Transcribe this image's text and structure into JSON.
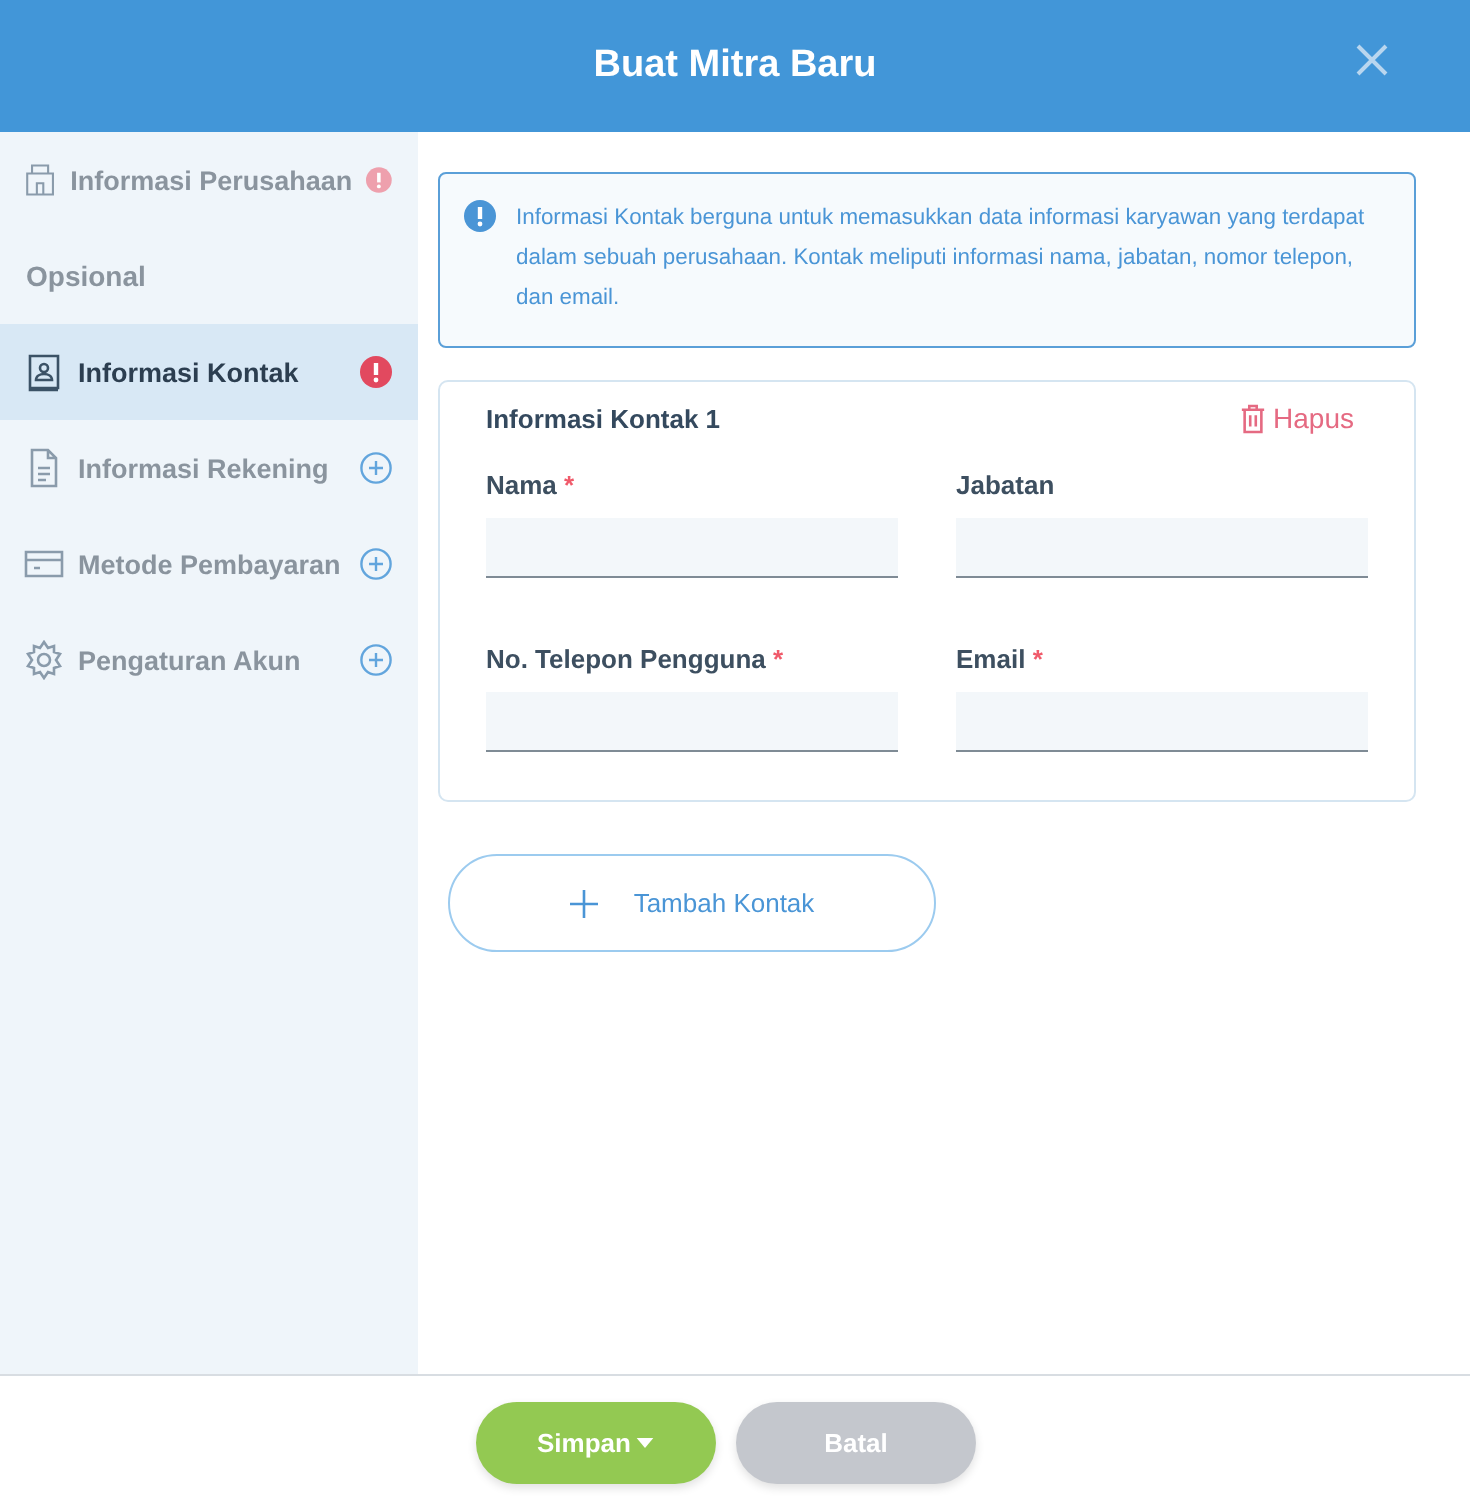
{
  "dialog": {
    "title": "Buat Mitra Baru"
  },
  "sidebar": {
    "items": [
      {
        "kind": "item",
        "label": "Informasi Perusahaan",
        "selected": false,
        "alert": true
      },
      {
        "kind": "section",
        "label": "Opsional"
      },
      {
        "kind": "item",
        "label": "Informasi Kontak",
        "selected": true,
        "alert": true
      },
      {
        "kind": "item",
        "label": "Informasi Rekening",
        "selected": false,
        "alert": false
      },
      {
        "kind": "item",
        "label": "Metode Pembayaran",
        "selected": false,
        "alert": false
      },
      {
        "kind": "item",
        "label": "Pengaturan Akun",
        "selected": false,
        "alert": false
      }
    ]
  },
  "info": "Informasi Kontak berguna untuk memasukkan data informasi karyawan yang terdapat dalam sebuah perusahaan. Kontak meliputi informasi nama, jabatan, nomor telepon, dan email.",
  "contacts": [
    {
      "title": "Informasi Kontak 1",
      "delete_label": "Hapus",
      "fields": [
        {
          "label": "Nama",
          "mark": "*"
        },
        {
          "label": "Jabatan"
        },
        {
          "label": "No. Telepon Pengguna",
          "mark": "*"
        },
        {
          "label": "Email",
          "mark": "*"
        }
      ]
    }
  ],
  "add_button": "Tambah Kontak",
  "buttons": [
    {
      "label": "Simpan",
      "kind": "primary",
      "dropdown": true
    },
    {
      "label": "Batal",
      "kind": "disabled",
      "dropdown": false
    }
  ]
}
